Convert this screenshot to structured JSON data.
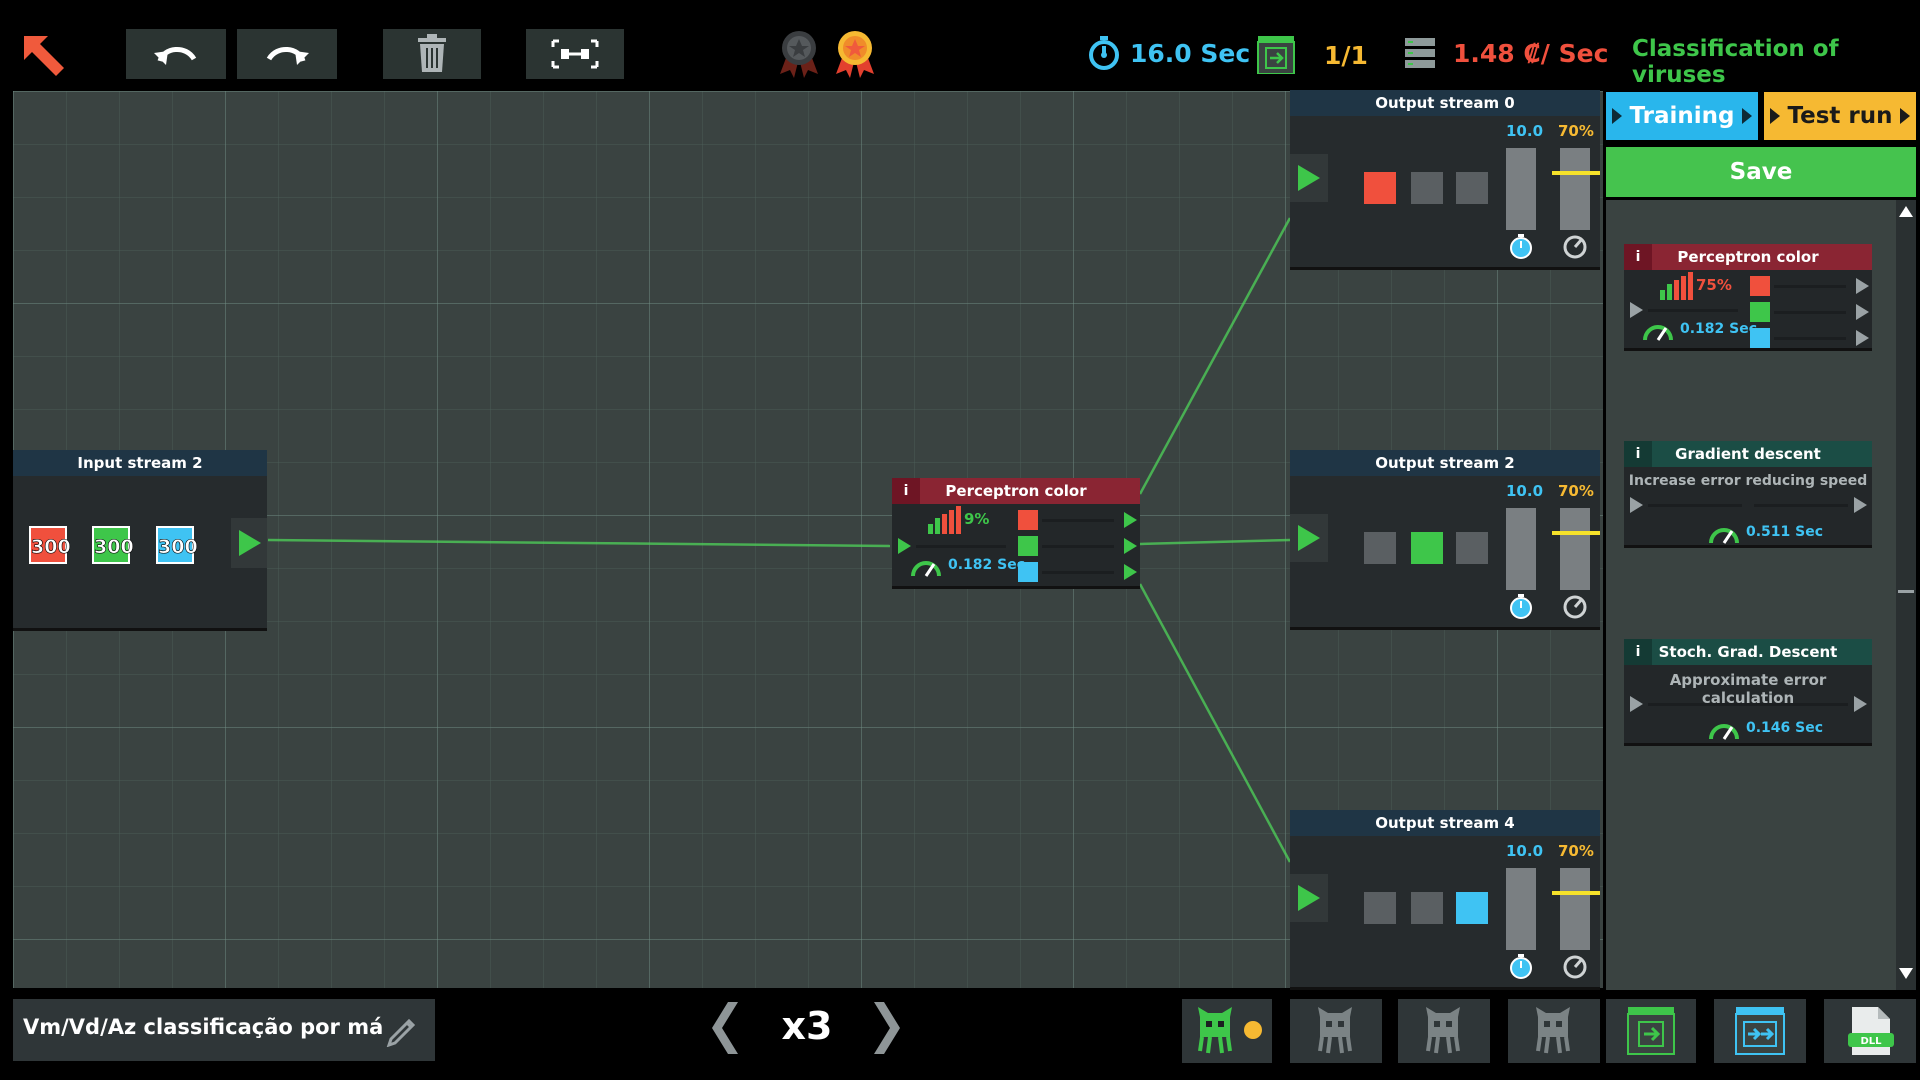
{
  "toolbar": {
    "back_icon": "arrow-back-icon",
    "undo_icon": "undo-icon",
    "redo_icon": "redo-icon",
    "delete_icon": "trash-icon",
    "arrange_icon": "arrange-icon",
    "medals": [
      "medal-bronze-icon",
      "medal-gold-icon"
    ]
  },
  "stats": {
    "time": "16.0 Sec",
    "level_progress": "1/1",
    "cost": "1.48 ₡/ Sec"
  },
  "level_title": "Classification of viruses",
  "buttons": {
    "training": "Training",
    "test_run": "Test run",
    "save": "Save"
  },
  "input_node": {
    "title": "Input stream 2",
    "values": [
      "300",
      "300",
      "300"
    ]
  },
  "perceptron_node": {
    "info": "i",
    "title": "Perceptron color",
    "accuracy": "9%",
    "speed": "0.182 Sec"
  },
  "output_nodes": [
    {
      "title": "Output stream 0",
      "target": "10.0",
      "threshold": "70%",
      "active": 0
    },
    {
      "title": "Output stream 2",
      "target": "10.0",
      "threshold": "70%",
      "active": 1
    },
    {
      "title": "Output stream 4",
      "target": "10.0",
      "threshold": "70%",
      "active": 2
    }
  ],
  "palette": [
    {
      "info": "i",
      "title": "Perceptron color",
      "accuracy": "75%",
      "speed": "0.182 Sec"
    },
    {
      "info": "i",
      "title": "Gradient descent",
      "desc": "Increase error reducing speed",
      "speed": "0.511 Sec"
    },
    {
      "info": "i",
      "title": "Stoch. Grad. Descent",
      "desc": "Approximate error calculation",
      "speed": "0.146 Sec"
    }
  ],
  "bottom": {
    "project_name": "Vm/Vd/Az classificação por má",
    "speed": "x3"
  },
  "colors": {
    "red": "#f0503d",
    "green": "#3ec64a",
    "blue": "#3fc3f3",
    "yellow": "#f6b932",
    "accent_orange": "#f05a3c"
  }
}
